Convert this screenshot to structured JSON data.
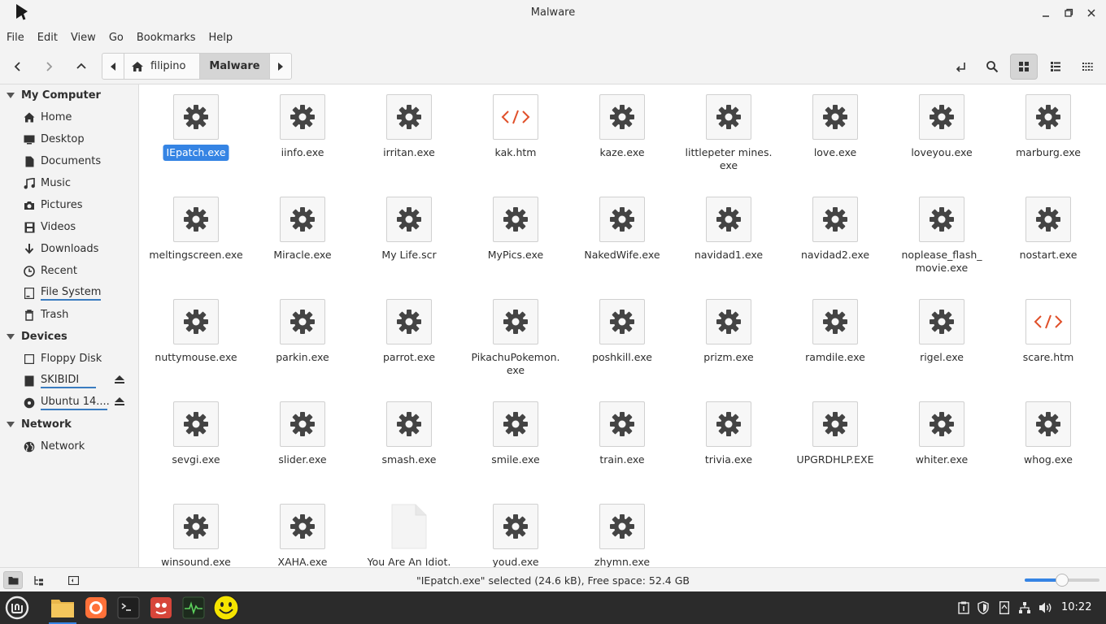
{
  "window": {
    "title": "Malware"
  },
  "menu": [
    "File",
    "Edit",
    "View",
    "Go",
    "Bookmarks",
    "Help"
  ],
  "path": {
    "segments": [
      "filipino",
      "Malware"
    ],
    "active": "Malware"
  },
  "sidebar": {
    "sections": [
      {
        "title": "My Computer",
        "items": [
          {
            "label": "Home",
            "icon": "home-icon"
          },
          {
            "label": "Desktop",
            "icon": "desktop-icon"
          },
          {
            "label": "Documents",
            "icon": "document-icon"
          },
          {
            "label": "Music",
            "icon": "music-icon"
          },
          {
            "label": "Pictures",
            "icon": "camera-icon"
          },
          {
            "label": "Videos",
            "icon": "film-icon"
          },
          {
            "label": "Downloads",
            "icon": "download-icon"
          },
          {
            "label": "Recent",
            "icon": "clock-icon"
          },
          {
            "label": "File System",
            "icon": "drive-icon"
          },
          {
            "label": "Trash",
            "icon": "trash-icon"
          }
        ]
      },
      {
        "title": "Devices",
        "items": [
          {
            "label": "Floppy Disk",
            "icon": "floppy-icon"
          },
          {
            "label": "SKIBIDI",
            "icon": "usb-drive-icon",
            "eject": true
          },
          {
            "label": "Ubuntu 14....",
            "icon": "disc-icon",
            "eject": true
          }
        ]
      },
      {
        "title": "Network",
        "items": [
          {
            "label": "Network",
            "icon": "globe-icon"
          }
        ]
      }
    ]
  },
  "files": [
    {
      "name": "IEpatch.exe",
      "type": "exe",
      "selected": true
    },
    {
      "name": "iinfo.exe",
      "type": "exe"
    },
    {
      "name": "irritan.exe",
      "type": "exe"
    },
    {
      "name": "kak.htm",
      "type": "htm"
    },
    {
      "name": "kaze.exe",
      "type": "exe"
    },
    {
      "name": "littlepeter mines.\nexe",
      "type": "exe"
    },
    {
      "name": "love.exe",
      "type": "exe"
    },
    {
      "name": "loveyou.exe",
      "type": "exe"
    },
    {
      "name": "marburg.exe",
      "type": "exe"
    },
    {
      "name": "meltingscreen.exe",
      "type": "exe"
    },
    {
      "name": "Miracle.exe",
      "type": "exe"
    },
    {
      "name": "My Life.scr",
      "type": "exe"
    },
    {
      "name": "MyPics.exe",
      "type": "exe"
    },
    {
      "name": "NakedWife.exe",
      "type": "exe"
    },
    {
      "name": "navidad1.exe",
      "type": "exe"
    },
    {
      "name": "navidad2.exe",
      "type": "exe"
    },
    {
      "name": "noplease_flash_\nmovie.exe",
      "type": "exe"
    },
    {
      "name": "nostart.exe",
      "type": "exe"
    },
    {
      "name": "nuttymouse.exe",
      "type": "exe"
    },
    {
      "name": "parkin.exe",
      "type": "exe"
    },
    {
      "name": "parrot.exe",
      "type": "exe"
    },
    {
      "name": "PikachuPokemon.\nexe",
      "type": "exe"
    },
    {
      "name": "poshkill.exe",
      "type": "exe"
    },
    {
      "name": "prizm.exe",
      "type": "exe"
    },
    {
      "name": "ramdile.exe",
      "type": "exe"
    },
    {
      "name": "rigel.exe",
      "type": "exe"
    },
    {
      "name": "scare.htm",
      "type": "htm"
    },
    {
      "name": "sevgi.exe",
      "type": "exe"
    },
    {
      "name": "slider.exe",
      "type": "exe"
    },
    {
      "name": "smash.exe",
      "type": "exe"
    },
    {
      "name": "smile.exe",
      "type": "exe"
    },
    {
      "name": "train.exe",
      "type": "exe"
    },
    {
      "name": "trivia.exe",
      "type": "exe"
    },
    {
      "name": "UPGRDHLP.EXE",
      "type": "exe"
    },
    {
      "name": "whiter.exe",
      "type": "exe"
    },
    {
      "name": "whog.exe",
      "type": "exe"
    },
    {
      "name": "winsound.exe",
      "type": "exe"
    },
    {
      "name": "XAHA.exe",
      "type": "exe"
    },
    {
      "name": "You Are An Idiot.",
      "type": "blank"
    },
    {
      "name": "youd.exe",
      "type": "exe"
    },
    {
      "name": "zhymn.exe",
      "type": "exe"
    }
  ],
  "status": {
    "text": "\"IEpatch.exe\" selected (24.6 kB), Free space: 52.4 GB",
    "zoom_level": 0.5
  },
  "taskbar": {
    "clock": "10:22"
  },
  "colors": {
    "accent": "#3584e4",
    "icon_gray": "#444444",
    "htm_orange": "#e0502a"
  }
}
